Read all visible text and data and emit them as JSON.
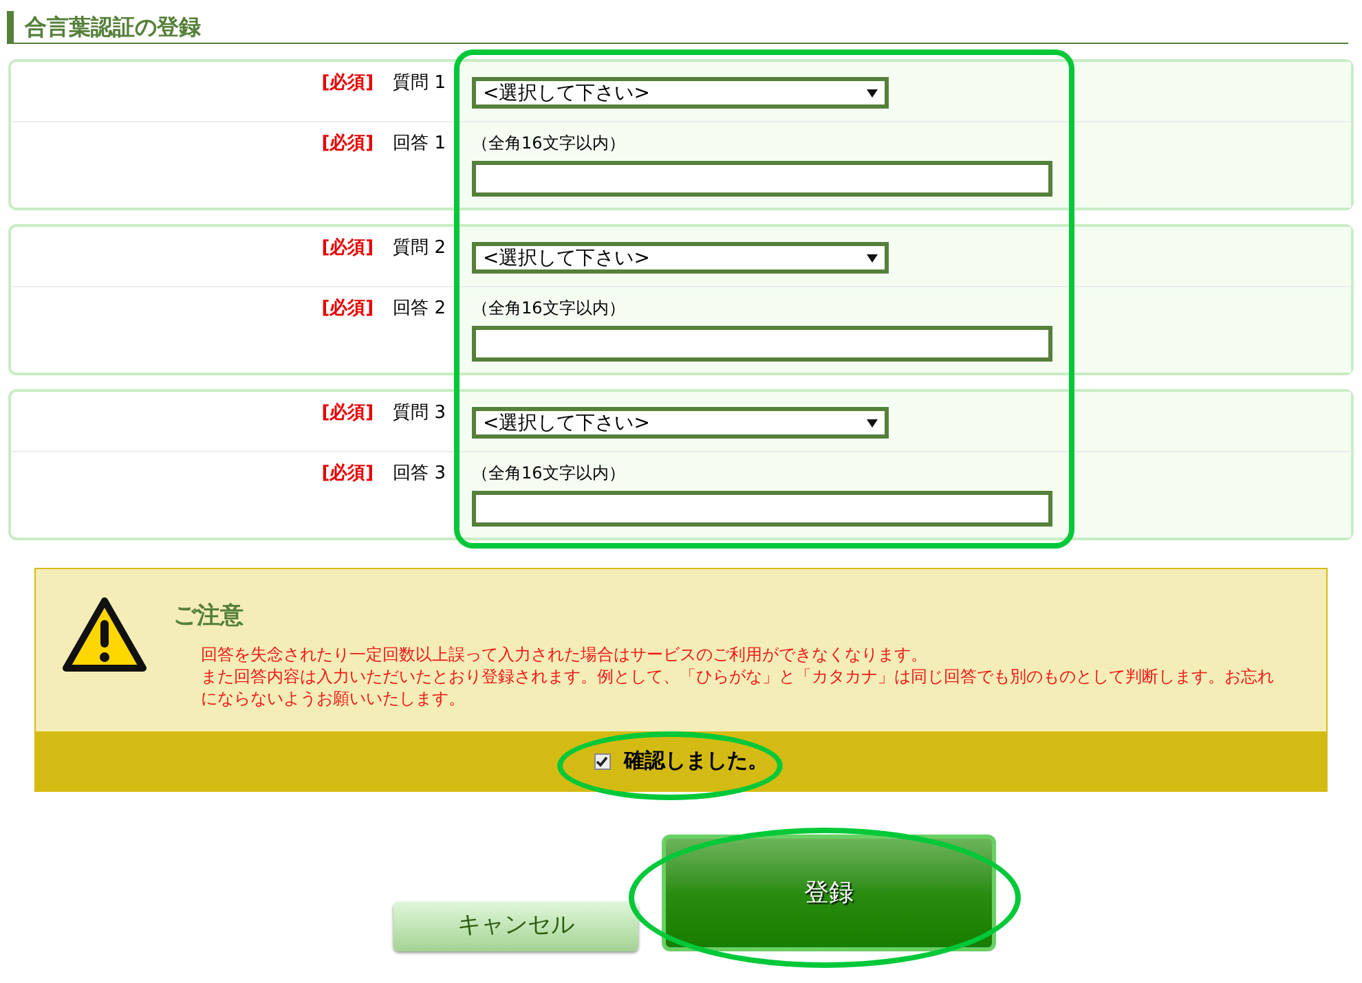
{
  "heading": "合言葉認証の登録",
  "groups": [
    {
      "question": {
        "required": "[必須]",
        "label": "質問 1",
        "select": "<選択して下さい>"
      },
      "answer": {
        "required": "[必須]",
        "label": "回答 1",
        "hint": "（全角16文字以内）"
      }
    },
    {
      "question": {
        "required": "[必須]",
        "label": "質問 2",
        "select": "<選択して下さい>"
      },
      "answer": {
        "required": "[必須]",
        "label": "回答 2",
        "hint": "（全角16文字以内）"
      }
    },
    {
      "question": {
        "required": "[必須]",
        "label": "質問 3",
        "select": "<選択して下さい>"
      },
      "answer": {
        "required": "[必須]",
        "label": "回答 3",
        "hint": "（全角16文字以内）"
      }
    }
  ],
  "notice": {
    "title": "ご注意",
    "lines": [
      "回答を失念されたり一定回数以上誤って入力された場合はサービスのご利用ができなくなります。",
      "また回答内容は入力いただいたとおり登録されます。例として、「ひらがな」と「カタカナ」は同じ回答でも別のものとして判断します。お忘れにならないようお願いいたします。"
    ],
    "confirm": {
      "label": "確認しました。",
      "checked": true
    }
  },
  "buttons": [
    {
      "kind": "cancel",
      "label": "キャンセル"
    },
    {
      "kind": "submit",
      "label": "登録"
    }
  ]
}
